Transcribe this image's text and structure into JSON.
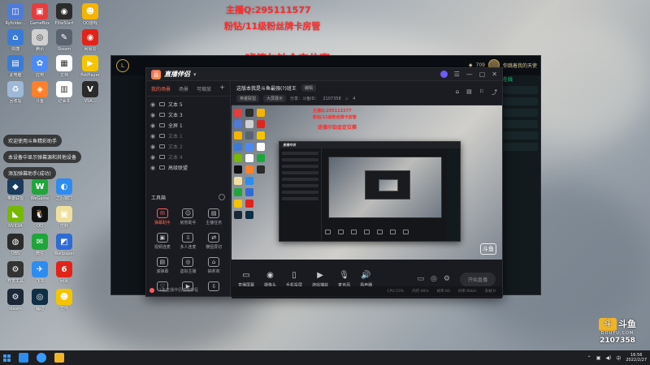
{
  "overlay": {
    "line1": "主播Q:295111577",
    "line2": "粉钻/11级粉丝牌卡房管",
    "line3": "班德尔铂金定位赛"
  },
  "desktop_icons": [
    {
      "label": "Ryfolder...",
      "color": "#4f7bd6",
      "glyph": "◫",
      "name": "folder-icon"
    },
    {
      "label": "GameBox",
      "color": "#e83c3c",
      "glyph": "▣",
      "name": "gamebox-icon"
    },
    {
      "label": "EliteStart",
      "color": "#2b2b2b",
      "glyph": "◉",
      "name": "elite-icon"
    },
    {
      "label": "QQ游戏",
      "color": "#f5b400",
      "glyph": "☻",
      "name": "qqgame-icon"
    },
    {
      "label": "快捷",
      "color": "#3a7bd5",
      "glyph": "⌂",
      "name": "computer-icon"
    },
    {
      "label": "腾讯",
      "color": "#d0d0d0",
      "glyph": "◎",
      "name": "tencent-icon"
    },
    {
      "label": "Steam",
      "color": "#5a6270",
      "glyph": "✎",
      "name": "pen-icon"
    },
    {
      "label": "网易云",
      "color": "#e2231a",
      "glyph": "◉",
      "name": "music-icon"
    },
    {
      "label": "此电脑",
      "color": "#3a7bd5",
      "glyph": "▤",
      "name": "pc-icon"
    },
    {
      "label": "应用",
      "color": "#4c8bf5",
      "glyph": "✿",
      "name": "app-icon"
    },
    {
      "label": "文档",
      "color": "#ffffff",
      "glyph": "▦",
      "name": "doc-icon"
    },
    {
      "label": "PotPlayer",
      "color": "#f5c400",
      "glyph": "▶",
      "name": "player-icon"
    },
    {
      "label": "回收站",
      "color": "#9fb8d8",
      "glyph": "♻",
      "name": "recycle-icon"
    },
    {
      "label": "斗鱼",
      "color": "#ff7f2a",
      "glyph": "◈",
      "name": "douyu-icon"
    },
    {
      "label": "记事本",
      "color": "#ffffff",
      "glyph": "▥",
      "name": "notepad-icon"
    },
    {
      "label": "VSA...",
      "color": "#2b2b2b",
      "glyph": "V",
      "name": "vsa-icon"
    }
  ],
  "desktop_icons_lower": [
    {
      "label": "英雄联盟",
      "color": "#1a3b5c",
      "glyph": "◆",
      "name": "lol-icon"
    },
    {
      "label": "WeGame",
      "color": "#1fa63a",
      "glyph": "W",
      "name": "wegame-icon"
    },
    {
      "label": "之后窗口",
      "color": "#2d8cf0",
      "glyph": "◐",
      "name": "window-icon"
    },
    {
      "label": "NVIDIA",
      "color": "#76b900",
      "glyph": "◣",
      "name": "nvidia-icon"
    },
    {
      "label": "QQ",
      "color": "#111111",
      "glyph": "🐧",
      "name": "qq-icon"
    },
    {
      "label": "控制",
      "color": "#f0e0a0",
      "glyph": "▣",
      "name": "control-icon"
    },
    {
      "label": "OBS",
      "color": "#2b2b2b",
      "glyph": "◍",
      "name": "obs-icon"
    },
    {
      "label": "微信",
      "color": "#1fa63a",
      "glyph": "✉",
      "name": "wechat-icon"
    },
    {
      "label": "Wallpaper",
      "color": "#2f6bd5",
      "glyph": "◩",
      "name": "wallpaper-icon"
    },
    {
      "label": "开发工具",
      "color": "#333333",
      "glyph": "⚙",
      "name": "tool-icon"
    },
    {
      "label": "飞书",
      "color": "#2d8cf0",
      "glyph": "✈",
      "name": "feishu-icon"
    },
    {
      "label": "网易",
      "color": "#e2231a",
      "glyph": "6",
      "name": "netease-icon"
    },
    {
      "label": "steam",
      "color": "#1b2838",
      "glyph": "⚙",
      "name": "steam-icon"
    },
    {
      "label": "辅助",
      "color": "#0f2f45",
      "glyph": "◎",
      "name": "helper-icon"
    },
    {
      "label": "文件",
      "color": "#f5c400",
      "glyph": "☻",
      "name": "file-icon"
    }
  ],
  "pills": [
    {
      "text": "欢迎使用斗鱼精彩助手"
    },
    {
      "text": "本设备中显示弹幕源和其他设备"
    },
    {
      "text": "添加弹幕助手(成功)"
    }
  ],
  "lol": {
    "rp_value": "709",
    "online_label": "在线",
    "avatar_caption": "你跳着我的天使"
  },
  "app": {
    "brand": "直播伴侣",
    "tabs": [
      "我的场景",
      "场景",
      "可缩放"
    ],
    "scenes": [
      {
        "label": "文本 5",
        "dim": false
      },
      {
        "label": "文本 3",
        "dim": false
      },
      {
        "label": "全屏 1",
        "dim": false
      },
      {
        "label": "文本 1",
        "dim": true
      },
      {
        "label": "文本 2",
        "dim": true
      },
      {
        "label": "文本 4",
        "dim": true
      },
      {
        "label": "高级联盟",
        "dim": false
      }
    ],
    "tools_title": "工具箱",
    "tools": [
      {
        "label": "弹幕助手",
        "icon": "✉",
        "highlight": true
      },
      {
        "label": "房管助手",
        "icon": "☺",
        "highlight": false
      },
      {
        "label": "主播任务",
        "icon": "▤",
        "highlight": false
      },
      {
        "label": "视频连麦",
        "icon": "▣",
        "highlight": false
      },
      {
        "label": "多人连麦",
        "icon": "⇩",
        "highlight": false
      },
      {
        "label": "横竖屏切",
        "icon": "⇄",
        "highlight": false
      },
      {
        "label": "滚弹幕",
        "icon": "▤",
        "highlight": false
      },
      {
        "label": "虚拟主播",
        "icon": "◎",
        "highlight": false
      },
      {
        "label": "抽奖商",
        "icon": "⌂",
        "highlight": false
      },
      {
        "label": "",
        "icon": "♡",
        "highlight": false
      },
      {
        "label": "",
        "icon": "▶",
        "highlight": false
      },
      {
        "label": "",
        "icon": "⇩",
        "highlight": false
      }
    ],
    "footer": "斗鱼直播伴侣使用教程",
    "room_title": "这版本我是斗鱼最强(?)班王",
    "room_tag": "编辑",
    "room_cat": "英雄联盟",
    "room_subcat": "大屏展示",
    "room_id_label": "分享：斗鱼ID：",
    "room_id": "2107358",
    "room_fans": "4",
    "bottom_controls": [
      {
        "label": "直播屏幕",
        "icon": "▭"
      },
      {
        "label": "摄像头",
        "icon": "◉"
      },
      {
        "label": "手机投屏",
        "icon": "▯"
      },
      {
        "label": "游戏捕获",
        "icon": "▶"
      },
      {
        "label": "麦克风",
        "icon": "🎙"
      },
      {
        "label": "扬声器",
        "icon": "🔊"
      }
    ],
    "start_button": "开始直播",
    "status": [
      "CPU:15%",
      "内存:46%",
      "帧率:60",
      "码率:0kb/s",
      "丢帧:0"
    ]
  },
  "preview": {
    "text1": "主播Q:295111577",
    "text2": "粉钻/11级粉丝牌卡房管",
    "text3": "班德尔铂金定位赛",
    "nested_brand": "直播伴侣"
  },
  "watermark": {
    "logo_text": "斗鱼",
    "sub": "DOUYU.COM",
    "room_number": "2107358"
  },
  "taskbar": {
    "time": "16:56",
    "date": "2022/2/27",
    "lang": "中"
  }
}
